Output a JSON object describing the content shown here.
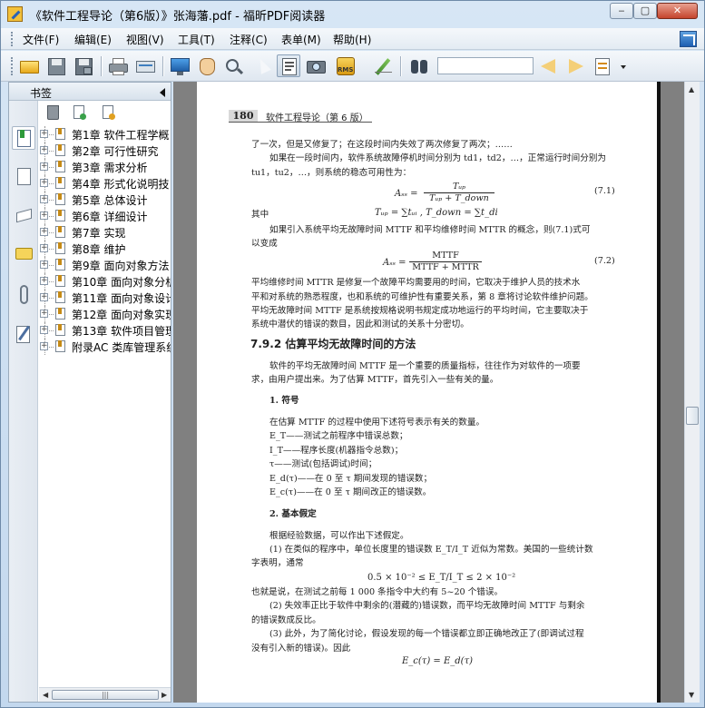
{
  "window": {
    "title": "《软件工程导论（第6版）》张海藩.pdf - 福昕PDF阅读器",
    "controls": {
      "minimize": "‒",
      "maximize": "▢",
      "close": "✕"
    }
  },
  "menu": {
    "items": [
      "文件(F)",
      "编辑(E)",
      "视图(V)",
      "工具(T)",
      "注释(C)",
      "表单(M)",
      "帮助(H)"
    ]
  },
  "toolbar": {
    "search_value": "",
    "icons": [
      "open-folder-icon",
      "save-icon",
      "save-all-icon",
      "print-icon",
      "scan-icon",
      "fullscreen-icon",
      "hand-tool-icon",
      "zoom-tool-icon",
      "select-arrow-icon",
      "text-select-icon",
      "snapshot-icon",
      "rms-icon",
      "sign-icon",
      "binoculars-icon",
      "find-previous-icon",
      "find-next-icon",
      "search-options-icon"
    ],
    "rms_label": "RMS"
  },
  "sidebar": {
    "title": "书签",
    "tabs": [
      "bookmarks-icon",
      "pages-icon",
      "layers-icon",
      "comments-icon",
      "attachments-icon",
      "signatures-icon"
    ],
    "bookmarks": [
      "第1章 软件工程学概",
      "第2章 可行性研究",
      "第3章 需求分析",
      "第4章 形式化说明技",
      "第5章 总体设计",
      "第6章 详细设计",
      "第7章 实现",
      "第8章 维护",
      "第9章 面向对象方法",
      "第10章 面向对象分析",
      "第11章 面向对象设计",
      "第12章 面向对象实现",
      "第13章 软件项目管理",
      "附录AC 类库管理系统"
    ]
  },
  "document": {
    "page_number": "180",
    "running_title": "软件工程导论（第 6 版）",
    "lines": [
      "了一次，但是又修复了；在这段时间内失效了两次修复了两次；……",
      "如果在一段时间内，软件系统故障停机时间分别为 td1，td2，…，正常运行时间分别为",
      "tu1，tu2，…，则系统的稳态可用性为：",
      "其中",
      "如果引入系统平均无故障时间 MTTF 和平均维修时间 MTTR 的概念，则(7.1)式可",
      "以变成",
      "平均维修时间 MTTR 是修复一个故障平均需要用的时间，它取决于维护人员的技术水",
      "平和对系统的熟悉程度，也和系统的可维护性有重要关系，第 8 章将讨论软件维护问题。",
      "平均无故障时间 MTTF 是系统按规格说明书规定成功地运行的平均时间，它主要取决于",
      "系统中潜伏的错误的数目，因此和测试的关系十分密切。"
    ],
    "eq1": {
      "lhs": "Aₛₛ =",
      "num": "Tᵤₚ",
      "den": "Tᵤₚ + T_down",
      "number": "(7.1)"
    },
    "eq_where": "Tᵤₚ = ∑tᵤᵢ , T_down = ∑t_di",
    "eq2": {
      "lhs": "Aₛₛ =",
      "num": "MTTF",
      "den": "MTTF + MTTR",
      "number": "(7.2)"
    },
    "section": "7.9.2   估算平均无故障时间的方法",
    "section_lines": [
      "软件的平均无故障时间 MTTF 是一个重要的质量指标，往往作为对软件的一项要",
      "求，由用户提出来。为了估算 MTTF，首先引入一些有关的量。"
    ],
    "sub1": "1. 符号",
    "sub1_lines": [
      "在估算 MTTF 的过程中使用下述符号表示有关的数量。",
      "E_T——测试之前程序中错误总数；",
      "I_T——程序长度(机器指令总数)；",
      "τ——测试(包括调试)时间；",
      "E_d(τ)——在 0 至 τ 期间发现的错误数；",
      "E_c(τ)——在 0 至 τ 期间改正的错误数。"
    ],
    "sub2": "2. 基本假定",
    "sub2_lines": [
      "根据经验数据，可以作出下述假定。",
      "(1) 在类似的程序中，单位长度里的错误数 E_T/I_T 近似为常数。美国的一些统计数",
      "字表明，通常",
      "0.5 × 10⁻² ≤ E_T/I_T ≤ 2 × 10⁻²",
      "也就是说，在测试之前每 1 000 条指令中大约有 5~20 个错误。",
      "(2) 失效率正比于软件中剩余的(潜藏的)错误数，而平均无故障时间 MTTF 与剩余",
      "的错误数成反比。",
      "(3) 此外，为了简化讨论，假设发现的每一个错误都立即正确地改正了(即调试过程",
      "没有引入新的错误)。因此",
      "E_c(τ) = E_d(τ)"
    ]
  },
  "colors": {
    "chrome": "#c3d8ee",
    "viewer_bg": "#808080",
    "page": "#ffffff",
    "accent": "#2a63b8"
  }
}
